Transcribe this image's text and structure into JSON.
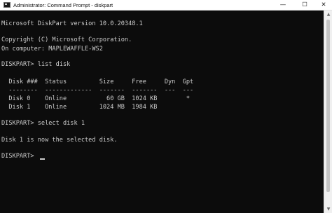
{
  "window": {
    "title": "Administrator: Command Prompt - diskpart",
    "minimize_glyph": "—",
    "maximize_glyph": "☐",
    "close_glyph": "✕",
    "icon": "cmd-icon"
  },
  "console": {
    "lines": [
      "Microsoft DiskPart version 10.0.20348.1",
      "Copyright (C) Microsoft Corporation.",
      "On computer: MAPLEWAFFLE-WS2",
      "DISKPART> list disk",
      "  Disk ###  Status         Size     Free     Dyn  Gpt",
      "  --------  -------------  -------  -------  ---  ---",
      "  Disk 0    Online           60 GB  1024 KB        *",
      "  Disk 1    Online         1024 MB  1984 KB",
      "DISKPART> select disk 1",
      "Disk 1 is now the selected disk.",
      "DISKPART> "
    ]
  },
  "scrollbar": {
    "up_glyph": "▲",
    "down_glyph": "▼"
  }
}
